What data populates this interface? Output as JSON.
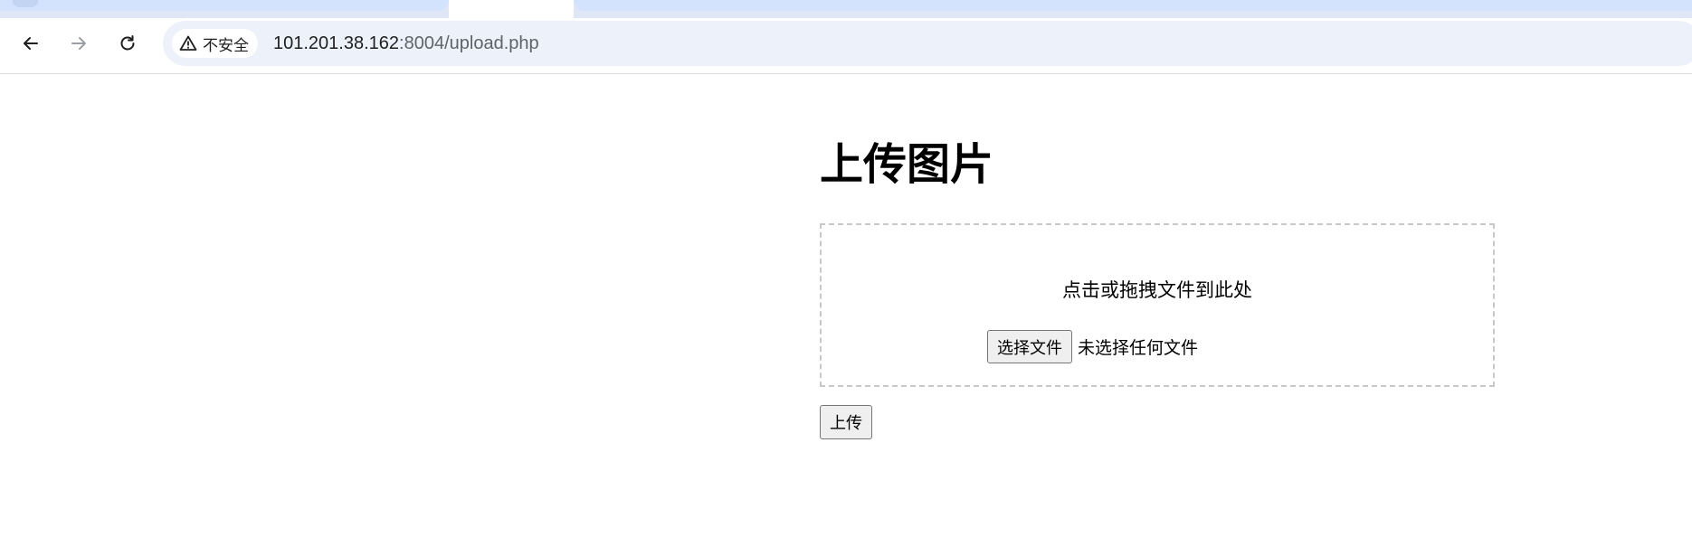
{
  "browser": {
    "security_label": "不安全",
    "url_host": "101.201.38.162",
    "url_rest": ":8004/upload.php",
    "icons": {
      "back": "back-arrow-icon",
      "forward": "forward-arrow-icon",
      "reload": "reload-icon",
      "warning": "warning-triangle-icon"
    }
  },
  "page": {
    "title": "上传图片",
    "dropzone": {
      "hint": "点击或拖拽文件到此处",
      "choose_button": "选择文件",
      "file_status": "未选择任何文件"
    },
    "upload_button": "上传"
  },
  "colors": {
    "omnibox_bg": "#edf2fa",
    "tabstrip_bg": "#d3e3fd",
    "dropzone_border": "#c8c8c8"
  }
}
